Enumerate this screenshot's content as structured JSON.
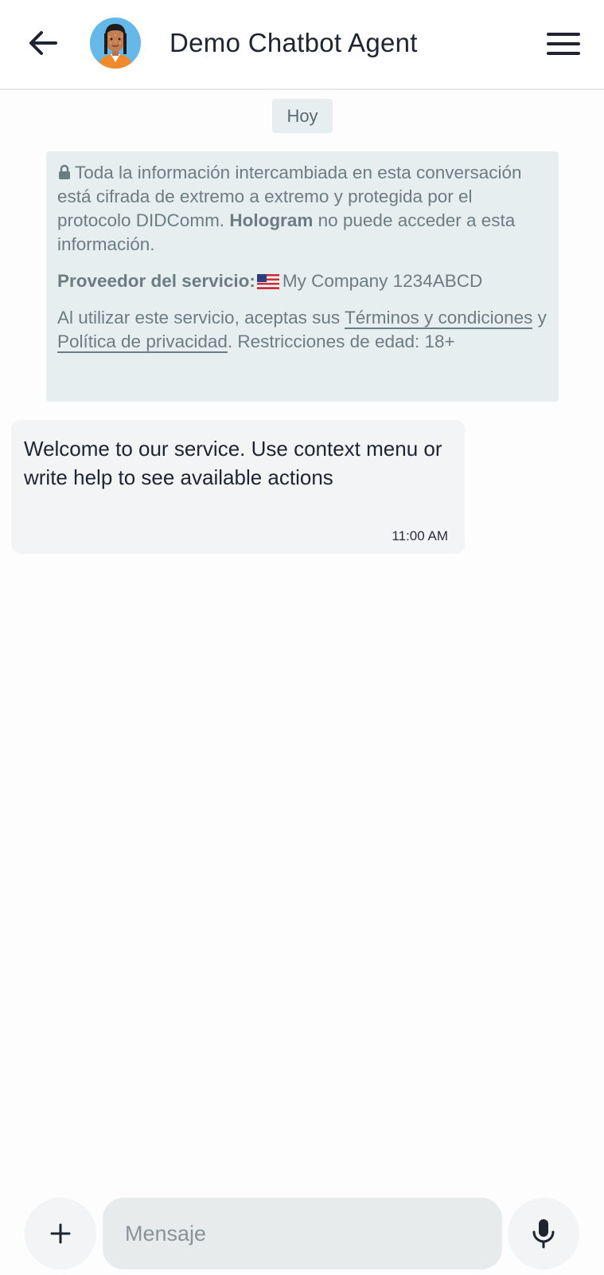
{
  "header": {
    "title": "Demo Chatbot Agent",
    "back_icon": "arrow-left-icon",
    "menu_icon": "hamburger-menu-icon"
  },
  "day_chip": "Hoy",
  "info": {
    "encryption_text": "Toda la información intercambiada en esta conversación está cifrada de extremo a extremo y protegida por el protocolo DIDComm.",
    "brand": "Hologram",
    "encryption_suffix": "no puede acceder a esta información.",
    "provider_label": "Proveedor del servicio:",
    "provider_flag": "us-flag-icon",
    "provider_name": "My Company 1234ABCD",
    "terms_prefix": "Al utilizar este servicio, aceptas sus",
    "terms_link": "Términos y condiciones",
    "and": "y",
    "privacy_link": "Política de privacidad",
    "age_restriction": ". Restricciones de edad: 18+"
  },
  "messages": [
    {
      "text": "Welcome to our service. Use context menu or write help to see available actions",
      "time": "11:00 AM"
    }
  ],
  "composer": {
    "placeholder": "Mensaje",
    "value": "",
    "plus_icon": "plus-icon",
    "mic_icon": "microphone-icon"
  },
  "colors": {
    "header_bg": "#ffffff",
    "info_bg": "#e7eef0",
    "bubble_bg": "#f2f4f6",
    "input_bg": "#e8ebec",
    "text_dark": "#1f2430",
    "text_muted": "#6d7c80"
  }
}
